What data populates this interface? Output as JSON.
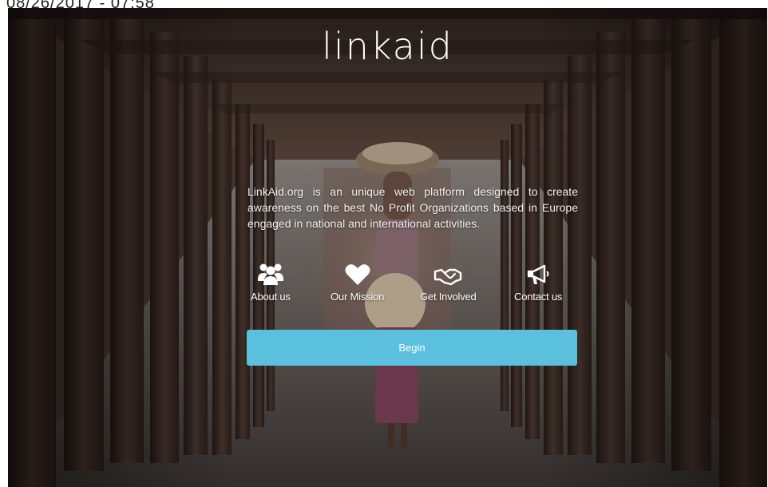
{
  "screen": {
    "timestamp": "08/26/2017 - 07:58"
  },
  "header": {
    "logo_text": "linkaid"
  },
  "intro": {
    "description": "LinkAid.org is an unique web platform designed to create awareness on the best No Profit Organizations based in Europe engaged in national and international activities."
  },
  "nav": {
    "items": [
      {
        "label": "About us",
        "icon": "users-icon"
      },
      {
        "label": "Our Mission",
        "icon": "heart-icon"
      },
      {
        "label": "Get Involved",
        "icon": "handshake-icon"
      },
      {
        "label": "Contact us",
        "icon": "megaphone-icon"
      }
    ]
  },
  "actions": {
    "begin_label": "Begin"
  },
  "theme": {
    "accent": "#5bc0de",
    "text": "#ffffff"
  }
}
